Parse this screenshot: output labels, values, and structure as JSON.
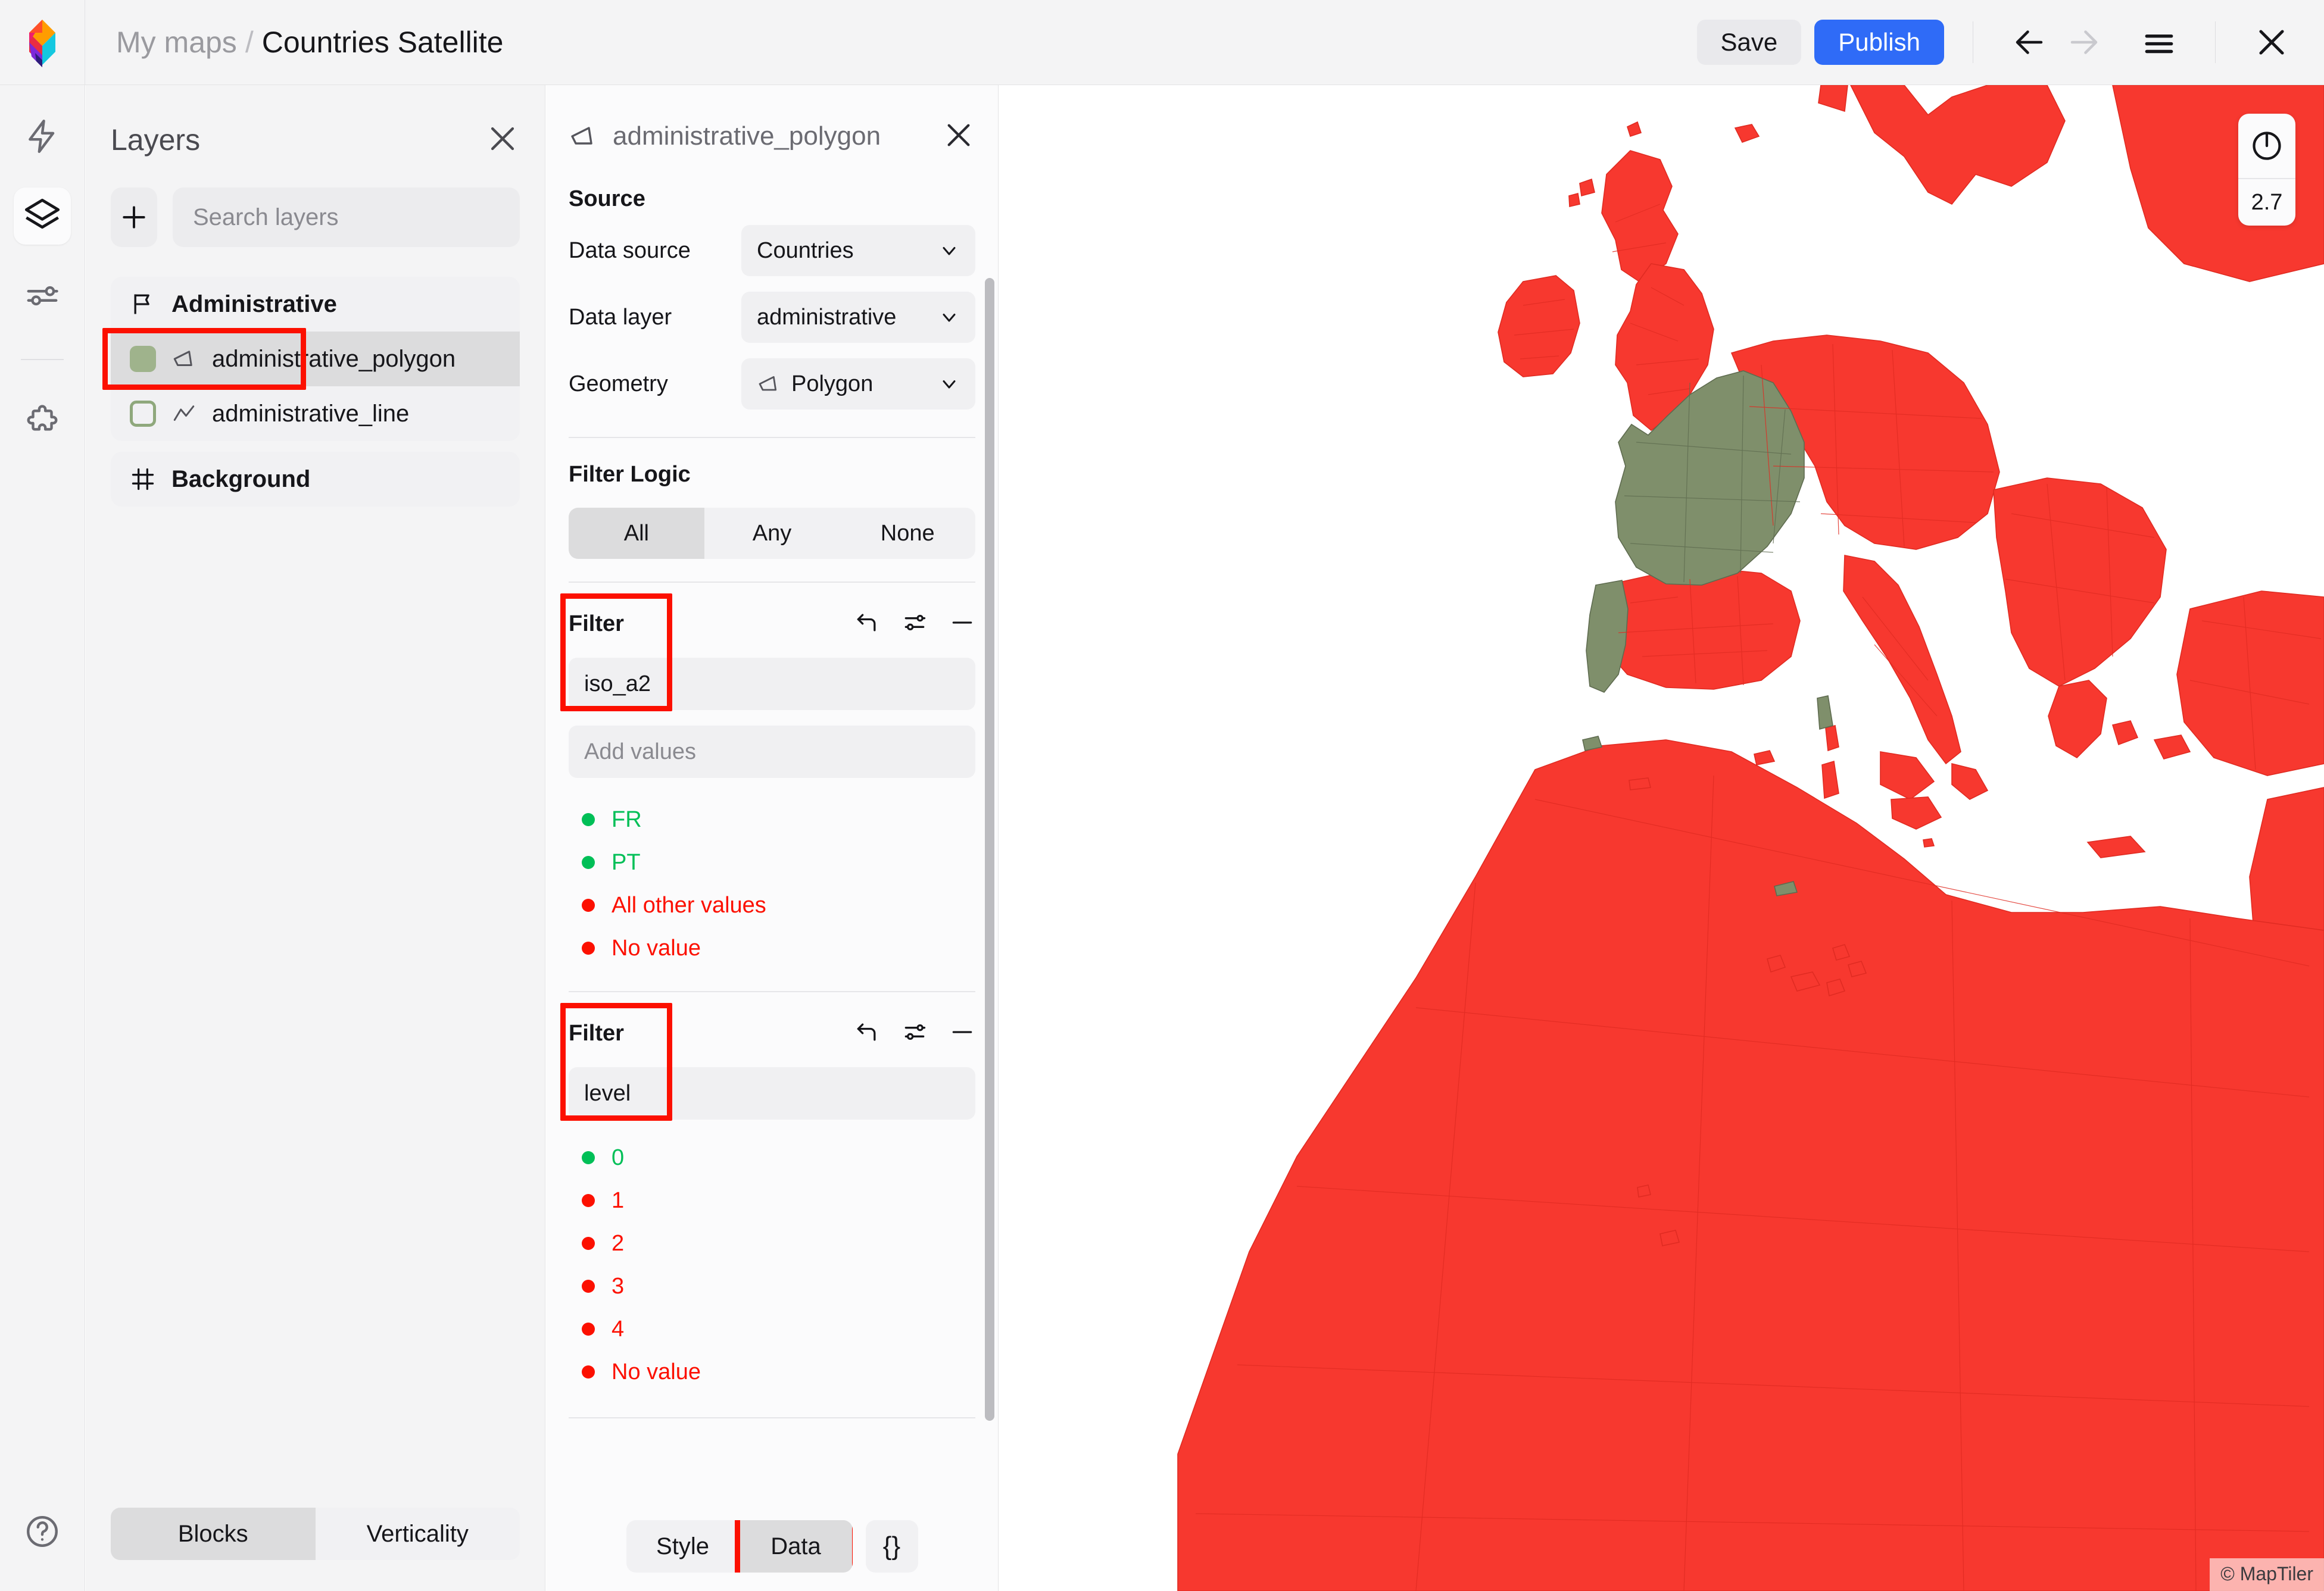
{
  "app": {
    "logo_icon": "maptiler-diamond-logo"
  },
  "breadcrumb": {
    "root": "My maps",
    "separator": "/",
    "current": "Countries Satellite"
  },
  "toolbar": {
    "save_label": "Save",
    "publish_label": "Publish",
    "back_icon": "arrow-left-icon",
    "forward_icon": "arrow-right-icon",
    "menu_icon": "hamburger-menu-icon",
    "close_icon": "close-icon",
    "publish_color": "#2f6bf7",
    "save_bg_color": "#e9e9ec"
  },
  "rail": {
    "items": [
      {
        "icon": "lightning-bolt-icon",
        "name": "quick-actions",
        "active": false
      },
      {
        "icon": "layers-icon",
        "name": "layers",
        "active": true
      },
      {
        "icon": "sliders-icon",
        "name": "settings",
        "active": false
      },
      {
        "icon": "puzzle-piece-icon",
        "name": "plugins",
        "active": false
      }
    ],
    "help_icon": "help-circle-icon"
  },
  "layers_panel": {
    "title": "Layers",
    "close_icon": "close-icon",
    "add_icon": "plus-icon",
    "search_placeholder": "Search layers",
    "search_value": "",
    "groups": [
      {
        "name": "Administrative",
        "icon": "flag-icon",
        "layers": [
          {
            "name": "administrative_polygon",
            "geometry_icon": "polygon-icon",
            "swatch": "filled",
            "swatch_color": "#9fb38c",
            "selected": true,
            "highlighted": true
          },
          {
            "name": "administrative_line",
            "geometry_icon": "line-icon",
            "swatch": "outlined",
            "swatch_color": "#8fa87c",
            "selected": false,
            "highlighted": false
          }
        ]
      },
      {
        "name": "Background",
        "icon": "frame-icon",
        "layers": []
      }
    ],
    "bottom_tabs": [
      {
        "label": "Blocks",
        "active": true
      },
      {
        "label": "Verticality",
        "active": false
      }
    ]
  },
  "props_panel": {
    "title": "administrative_polygon",
    "title_icon": "polygon-icon",
    "close_icon": "close-icon",
    "source": {
      "heading": "Source",
      "fields": [
        {
          "label": "Data source",
          "value": "Countries",
          "icon": null
        },
        {
          "label": "Data layer",
          "value": "administrative",
          "icon": null
        },
        {
          "label": "Geometry",
          "value": "Polygon",
          "icon": "polygon-icon"
        }
      ]
    },
    "filter_logic": {
      "heading": "Filter Logic",
      "options": [
        {
          "label": "All",
          "active": true
        },
        {
          "label": "Any",
          "active": false
        },
        {
          "label": "None",
          "active": false
        }
      ]
    },
    "filters": [
      {
        "heading": "Filter",
        "highlighted": true,
        "actions": [
          {
            "icon": "undo-icon",
            "name": "reset-filter"
          },
          {
            "icon": "sliders-icon",
            "name": "filter-options"
          },
          {
            "icon": "minus-icon",
            "name": "remove-filter"
          }
        ],
        "field_value": "iso_a2",
        "add_values_placeholder": "Add values",
        "values": [
          {
            "label": "FR",
            "color": "#00bf57"
          },
          {
            "label": "PT",
            "color": "#00bf57"
          },
          {
            "label": "All other values",
            "color": "#fc1000"
          },
          {
            "label": "No value",
            "color": "#fc1000"
          }
        ]
      },
      {
        "heading": "Filter",
        "highlighted": true,
        "actions": [
          {
            "icon": "undo-icon",
            "name": "reset-filter"
          },
          {
            "icon": "sliders-icon",
            "name": "filter-options"
          },
          {
            "icon": "minus-icon",
            "name": "remove-filter"
          }
        ],
        "field_value": "level",
        "add_values_placeholder": "",
        "values": [
          {
            "label": "0",
            "color": "#00bf57"
          },
          {
            "label": "1",
            "color": "#fc1000"
          },
          {
            "label": "2",
            "color": "#fc1000"
          },
          {
            "label": "3",
            "color": "#fc1000"
          },
          {
            "label": "4",
            "color": "#fc1000"
          },
          {
            "label": "No value",
            "color": "#fc1000"
          }
        ]
      }
    ],
    "bottom_tabs": [
      {
        "label": "Style",
        "active": false
      },
      {
        "label": "Data",
        "active": true,
        "highlighted": true
      }
    ],
    "json_button_label": "{}"
  },
  "map": {
    "zoom_level": "2.7",
    "compass_icon": "compass-icon",
    "attribution": "© MapTiler",
    "fill_default": "#f7382f",
    "fill_highlight": "#7f8f6b",
    "stroke_color": "#e02b22",
    "water_color": "#ffffff"
  }
}
